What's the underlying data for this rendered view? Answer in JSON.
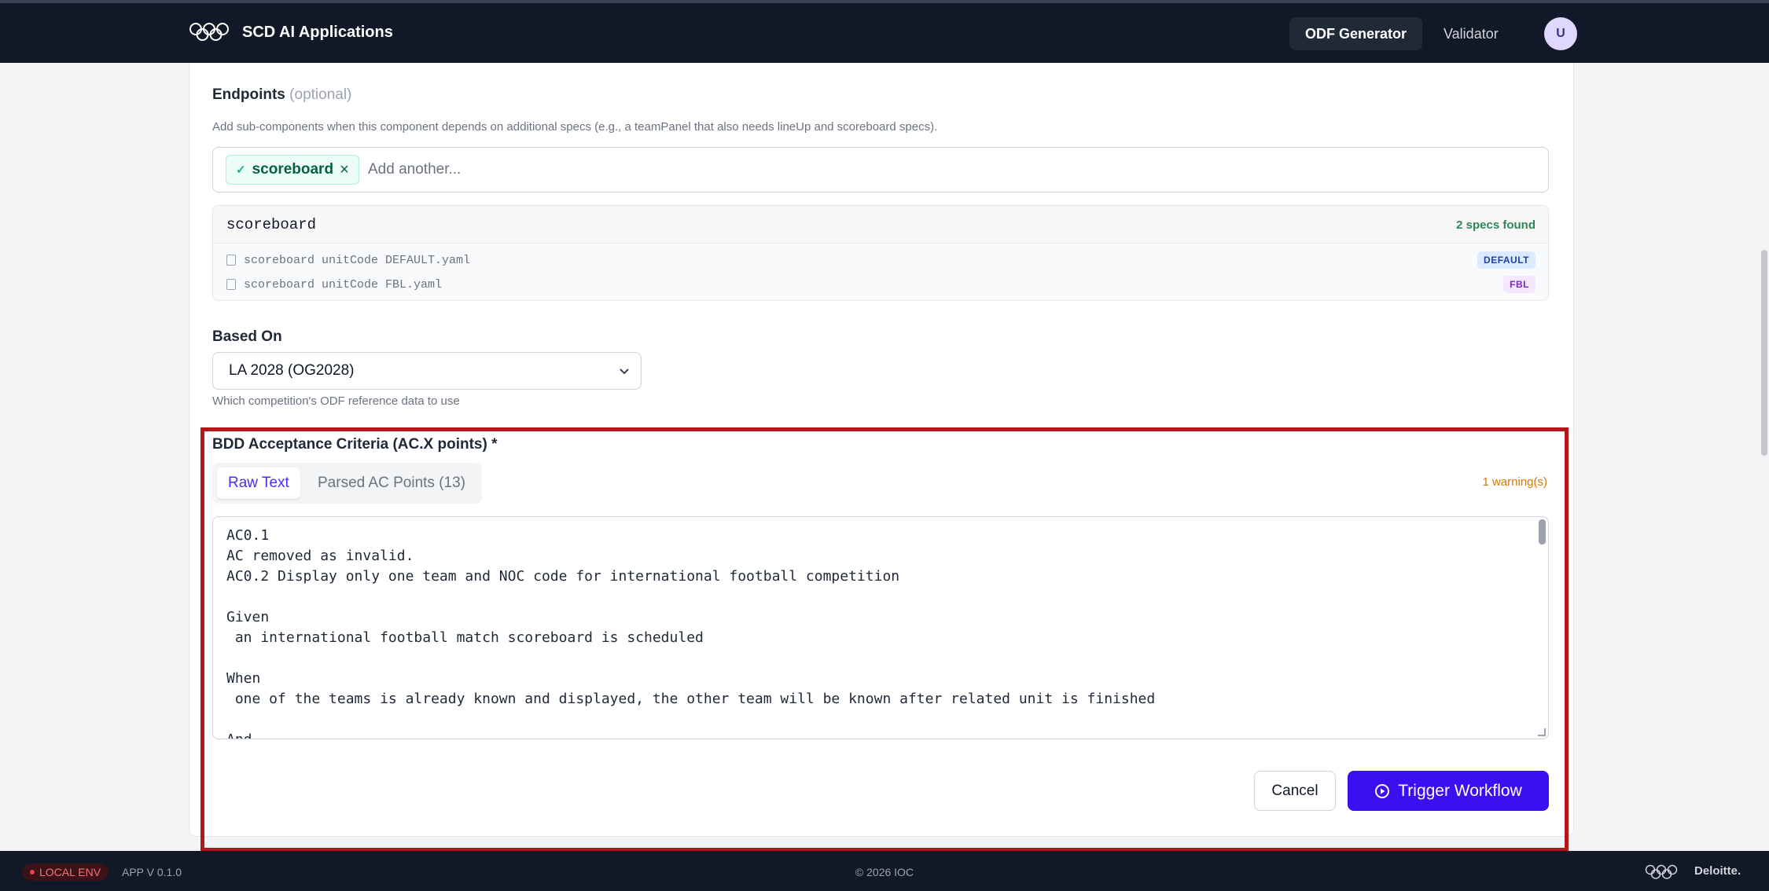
{
  "header": {
    "app_title": "SCD AI Applications",
    "tabs": [
      {
        "label": "ODF Generator",
        "active": true
      },
      {
        "label": "Validator",
        "active": false
      }
    ],
    "avatar_initial": "U"
  },
  "endpoints": {
    "label": "Endpoints",
    "optional": "(optional)",
    "help": "Add sub-components when this component depends on additional specs (e.g., a teamPanel that also needs lineUp and scoreboard specs).",
    "chips": [
      "scoreboard"
    ],
    "input_placeholder": "Add another...",
    "spec_group": {
      "name": "scoreboard",
      "count_text": "2 specs found",
      "files": [
        {
          "file": "scoreboard unitCode DEFAULT.yaml",
          "badge": "DEFAULT"
        },
        {
          "file": "scoreboard unitCode FBL.yaml",
          "badge": "FBL"
        }
      ]
    }
  },
  "based_on": {
    "label": "Based On",
    "selected": "LA 2028 (OG2028)",
    "help": "Which competition's ODF reference data to use"
  },
  "bdd": {
    "label": "BDD Acceptance Criteria (AC.X points) *",
    "tabs": [
      {
        "label": "Raw Text",
        "active": true
      },
      {
        "label": "Parsed AC Points (13)",
        "active": false
      }
    ],
    "warning": "1 warning(s)",
    "raw_text": "AC0.1\nAC removed as invalid.\nAC0.2 Display only one team and NOC code for international football competition\n\nGiven\n an international football match scoreboard is scheduled\n\nWhen\n one of the teams is already known and displayed, the other team will be known after related unit is finished\n\nAnd"
  },
  "actions": {
    "cancel": "Cancel",
    "trigger": "Trigger Workflow"
  },
  "footer": {
    "env": "LOCAL ENV",
    "version": "APP V 0.1.0",
    "copyright": "© 2026 IOC",
    "brand": "Deloitte."
  },
  "colors": {
    "nav_bg": "#111827",
    "accent": "#3a0ff0",
    "highlight": "#b4161b",
    "warning": "#d97706",
    "success": "#2f855a"
  }
}
